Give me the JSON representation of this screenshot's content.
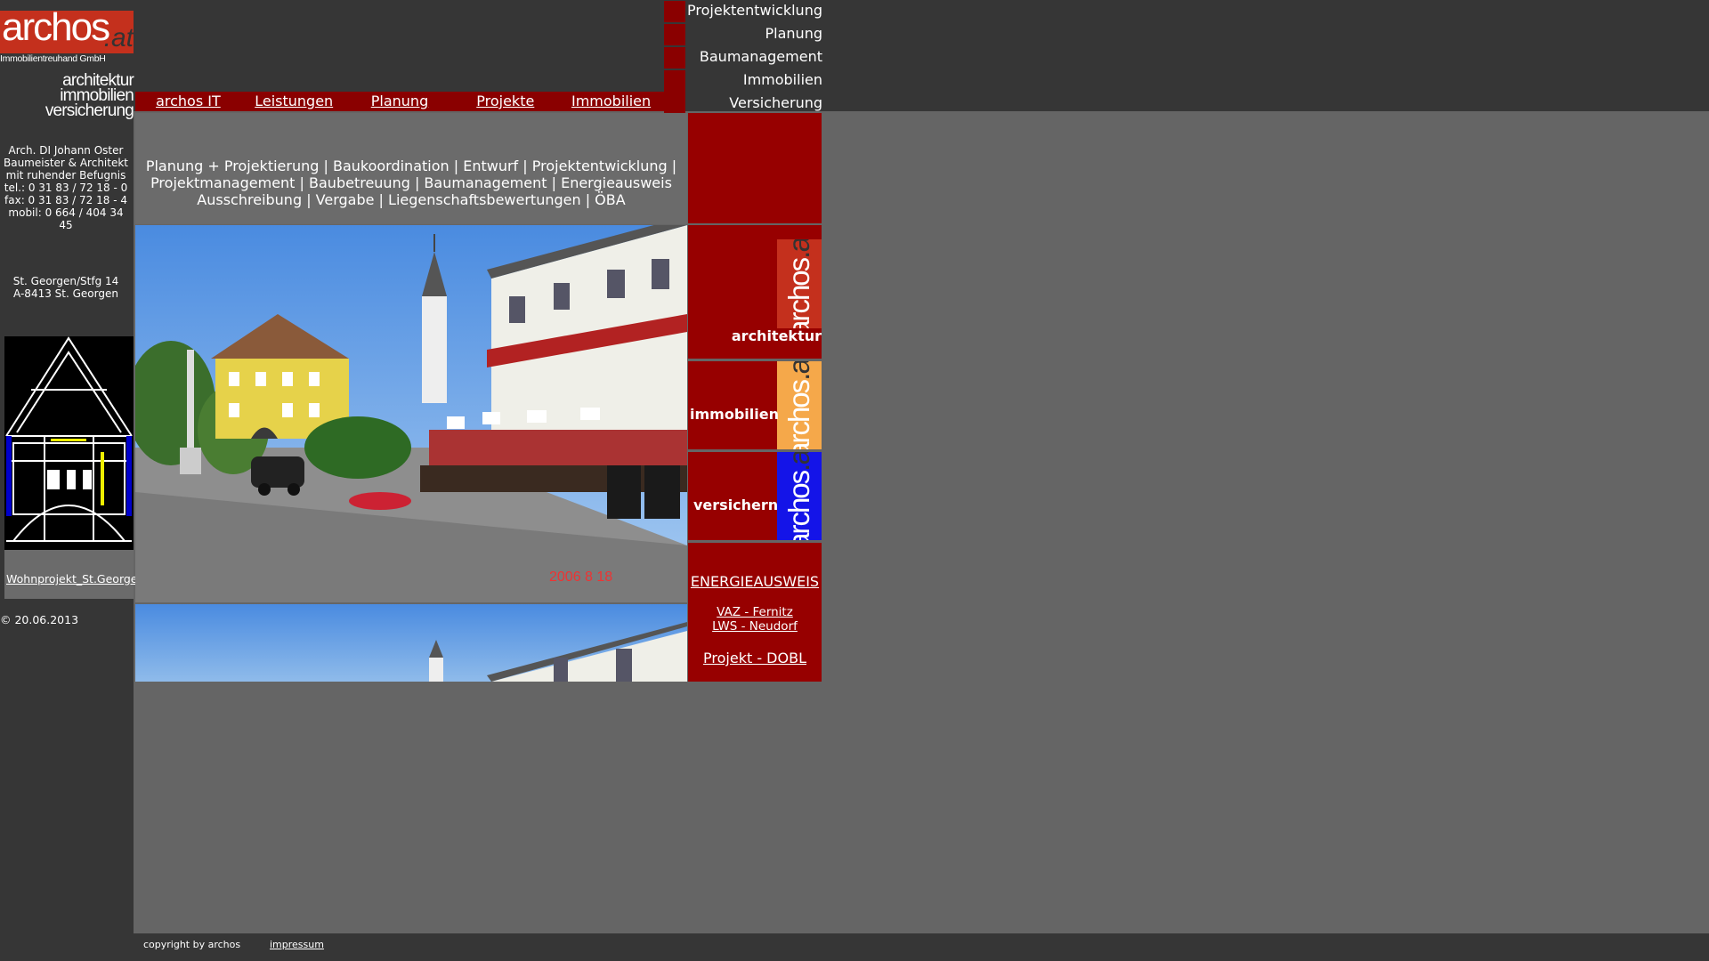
{
  "logo": {
    "word": "archos",
    "at": ".at",
    "subtitle": "Immobilientreuhand GmbH",
    "tagline": [
      "architektur",
      "immobilien",
      "versicherung"
    ]
  },
  "contact": {
    "lines": [
      "Arch. DI Johann Oster",
      "Baumeister & Architekt",
      "mit ruhender Befugnis",
      "tel.: 0 31 83 / 72 18 - 0",
      "fax: 0 31 83 / 72 18 - 4",
      "mobil: 0 664 / 404 34",
      "45"
    ],
    "address": [
      "St. Georgen/Stfg 14",
      "A-8413 St. Georgen"
    ]
  },
  "project_link": "Wohnprojekt_St.Georgen",
  "date": "© 20.06.2013",
  "top_nav": [
    "Projektentwicklung",
    "Planung",
    "Baumanagement",
    "Immobilien",
    "Versicherung"
  ],
  "main_menu": [
    "archos IT",
    "Leistungen",
    "Planung",
    "Projekte",
    "Immobilien"
  ],
  "services": {
    "line1": "Planung + Projektierung | Baukoordination | Entwurf | Projektentwicklung |",
    "line2": "Projektmanagement | Baubetreuung | Baumanagement | Energieausweis",
    "line3": "Ausschreibung | Vergabe | Liegenschaftsbewertungen | ÖBA"
  },
  "photo": {
    "date_stamp": "2006   8  18"
  },
  "right_column": {
    "architektur": "architektur",
    "immobilien": "immobilien",
    "versichern": "versichern",
    "vertical_word": "archos",
    "vertical_at": ".at",
    "energy": "ENERGIEAUSWEIS",
    "link1": "VAZ - Fernitz",
    "link2": "LWS - Neudorf ",
    "link3": "Projekt - DOBL",
    "colors": {
      "architektur": "#c4301d",
      "immobilien": "#f5a84a",
      "versichern": "#1414e8"
    }
  },
  "footer": {
    "copyright": "copyright by archos",
    "impressum": "impressum"
  }
}
